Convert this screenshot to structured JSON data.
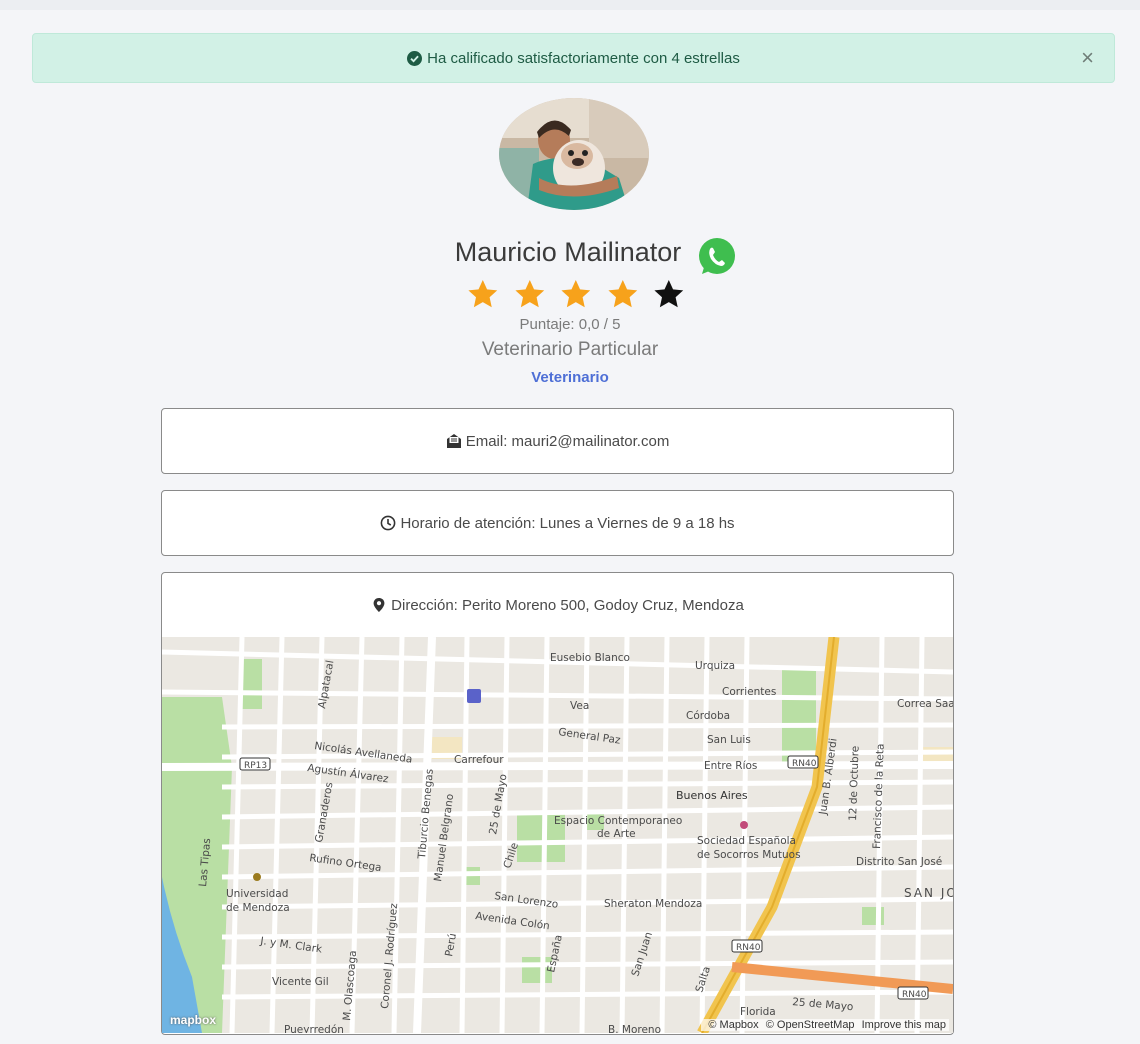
{
  "alert": {
    "message": "Ha calificado satisfactoriamente con 4 estrellas",
    "close_label": "×"
  },
  "profile": {
    "name": "Mauricio Mailinator",
    "rating_stars_filled": 4,
    "rating_stars_total": 5,
    "score_text": "Puntaje: 0,0 / 5",
    "type": "Veterinario Particular",
    "category": "Veterinario"
  },
  "cards": {
    "email": "Email: mauri2@mailinator.com",
    "schedule": "Horario de atención: Lunes a Viernes de 9 a 18 hs",
    "address": "Dirección: Perito Moreno 500, Godoy Cruz, Mendoza"
  },
  "map": {
    "labels": {
      "eusebio": "Eusebio Blanco",
      "urquiza": "Urquiza",
      "corrientes": "Corrientes",
      "correa": "Correa Saa",
      "vea": "Vea",
      "cordoba": "Córdoba",
      "alpatacal": "Alpatacal",
      "general_paz": "General Paz",
      "san_luis": "San Luis",
      "nicolas": "Nicolás Avellaneda",
      "carrefour": "Carrefour",
      "agustin": "Agustín Álvarez",
      "entre_rios": "Entre Ríos",
      "rp13": "RP13",
      "rn40a": "RN40",
      "juan_b": "Juan B. Alberdi",
      "doce_oct": "12 de Octubre",
      "francisco": "Francisco de la Reta",
      "buenos_aires": "Buenos Aires",
      "granaderos": "Granaderos",
      "tiburcio": "Tiburcio Benegas",
      "manuel": "Manuel Belgrano",
      "veinticinco": "25 de Mayo",
      "espacio1": "Espacio Contemporaneo",
      "espacio2": "de Arte",
      "sociedad1": "Sociedad Española",
      "sociedad2": "de Socorros Mutuos",
      "rufino": "Rufino Ortega",
      "chile": "Chile",
      "distrito": "Distrito San José",
      "las_tipas": "Las Tipas",
      "universidad1": "Universidad",
      "universidad2": "de Mendoza",
      "san_lorenzo": "San Lorenzo",
      "sheraton": "Sheraton Mendoza",
      "san_jo": "SAN JO",
      "avenida_colon": "Avenida Colón",
      "jym_clark": "J. y M. Clark",
      "coronel": "Coronel J. Rodríguez",
      "peru": "Perú",
      "espana": "España",
      "san_juan": "San Juan",
      "rn40b": "RN40",
      "vicente": "Vicente Gil",
      "olascoaga": "M. Olascoaga",
      "salta": "Salta",
      "veinticinco_b": "25 de Mayo",
      "rn40c": "RN40",
      "florida": "Florida",
      "pueyrredon": "Pueyrredón",
      "bmoreno": "B. Moreno"
    },
    "attribution_mapbox": "© Mapbox",
    "attribution_osm": "© OpenStreetMap",
    "improve": "Improve this map",
    "logo": "mapbox"
  },
  "colors": {
    "alert_bg": "#d2f1e6",
    "star_filled": "#f7a21b",
    "star_empty": "#111111",
    "category_link": "#4e6fd6",
    "whatsapp": "#3fbe4f"
  }
}
